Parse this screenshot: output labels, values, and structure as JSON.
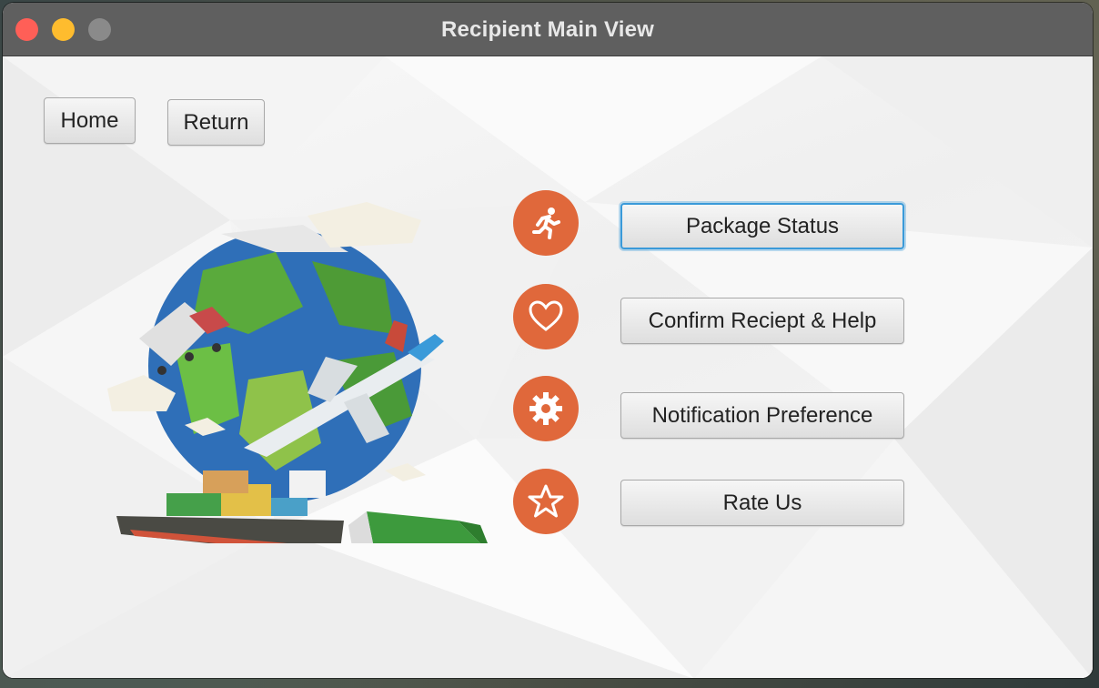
{
  "window": {
    "title": "Recipient Main View"
  },
  "colors": {
    "accent_orange": "#e0683b",
    "close": "#ff5f57",
    "minimize": "#febc2e",
    "maximize_inactive": "#8a8a8a",
    "focus_ring": "#3a9ad9"
  },
  "nav": {
    "home_label": "Home",
    "return_label": "Return"
  },
  "menu": {
    "items": [
      {
        "label": "Package Status",
        "icon": "running-person-icon",
        "focused": true
      },
      {
        "label": "Confirm Reciept & Help",
        "icon": "heart-icon",
        "focused": false
      },
      {
        "label": "Notification Preference",
        "icon": "gear-icon",
        "focused": false
      },
      {
        "label": "Rate Us",
        "icon": "star-icon",
        "focused": false
      }
    ]
  },
  "illustration": {
    "icon": "global-logistics-illustration"
  }
}
